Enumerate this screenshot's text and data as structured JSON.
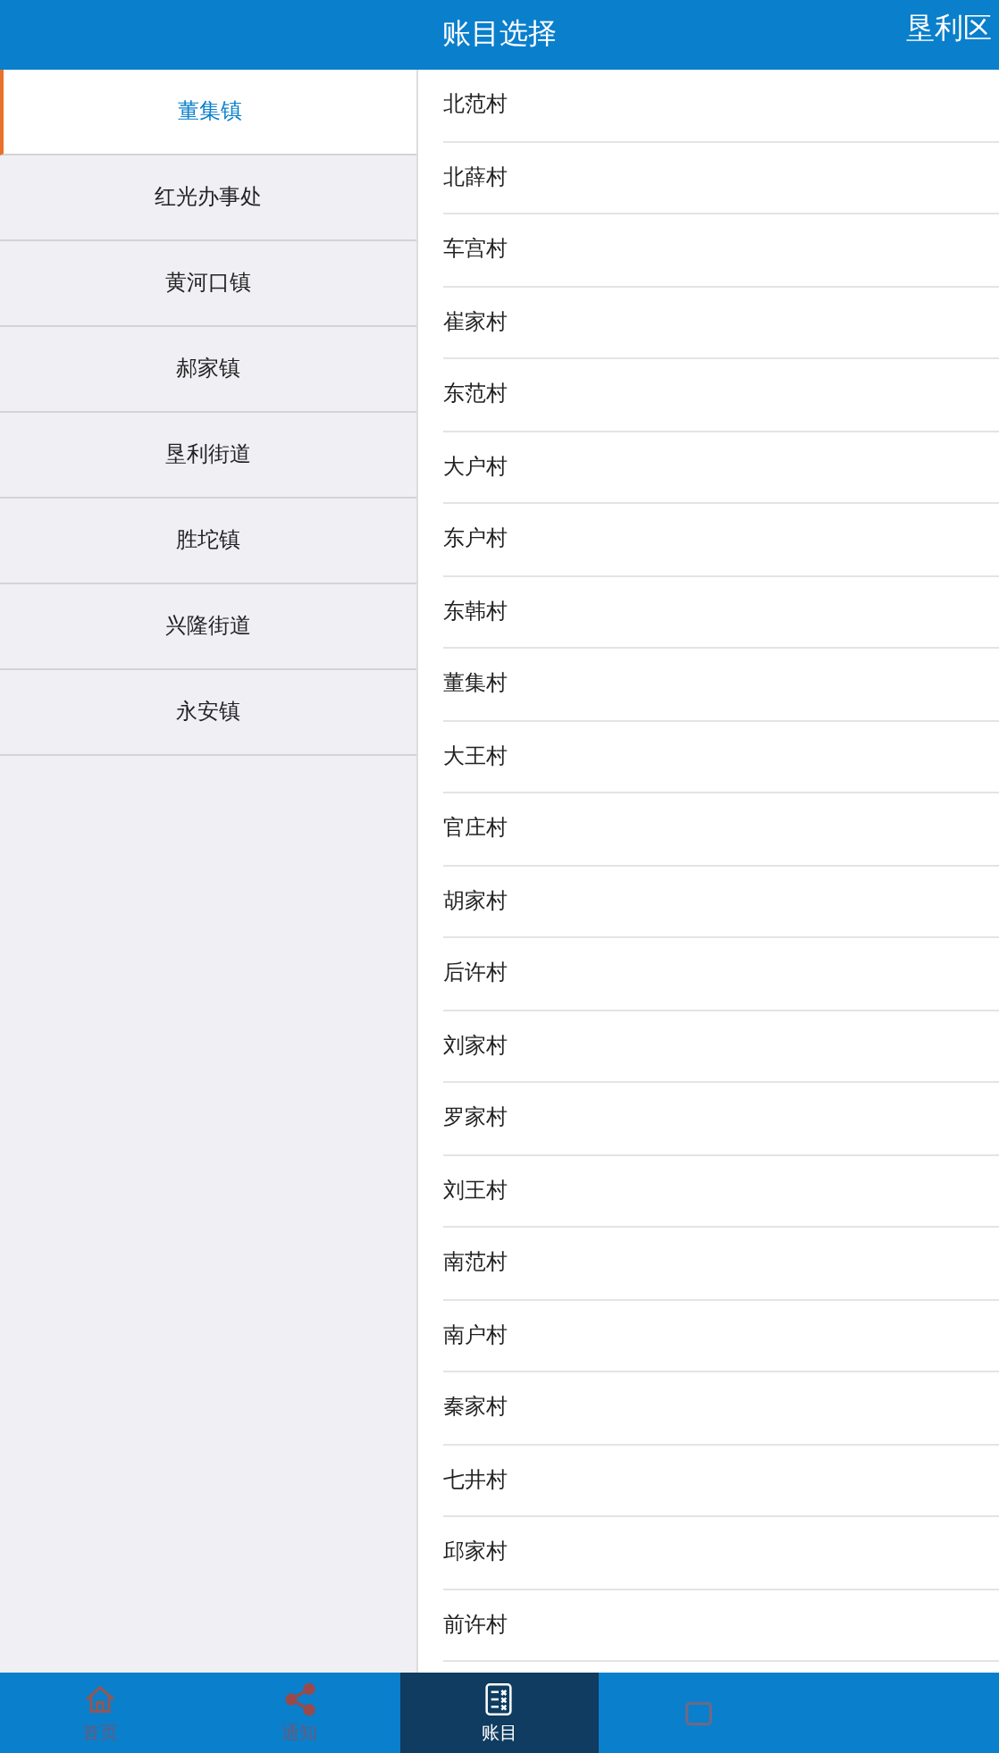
{
  "header": {
    "title": "账目选择",
    "region": "垦利区"
  },
  "towns": [
    {
      "label": "董集镇",
      "selected": true
    },
    {
      "label": "红光办事处",
      "selected": false
    },
    {
      "label": "黄河口镇",
      "selected": false
    },
    {
      "label": "郝家镇",
      "selected": false
    },
    {
      "label": "垦利街道",
      "selected": false
    },
    {
      "label": "胜坨镇",
      "selected": false
    },
    {
      "label": "兴隆街道",
      "selected": false
    },
    {
      "label": "永安镇",
      "selected": false
    }
  ],
  "villages": [
    "北范村",
    "北薛村",
    "车宫村",
    "崔家村",
    "东范村",
    "大户村",
    "东户村",
    "东韩村",
    "董集村",
    "大王村",
    "官庄村",
    "胡家村",
    "后许村",
    "刘家村",
    "罗家村",
    "刘王村",
    "南范村",
    "南户村",
    "秦家村",
    "七井村",
    "邱家村",
    "前许村"
  ],
  "tabs": [
    {
      "kind": "home",
      "label": "首页",
      "selected": false
    },
    {
      "kind": "share",
      "label": "通知",
      "selected": false
    },
    {
      "kind": "ledger",
      "label": "账目",
      "selected": true
    },
    {
      "kind": "square",
      "selected": false
    }
  ]
}
